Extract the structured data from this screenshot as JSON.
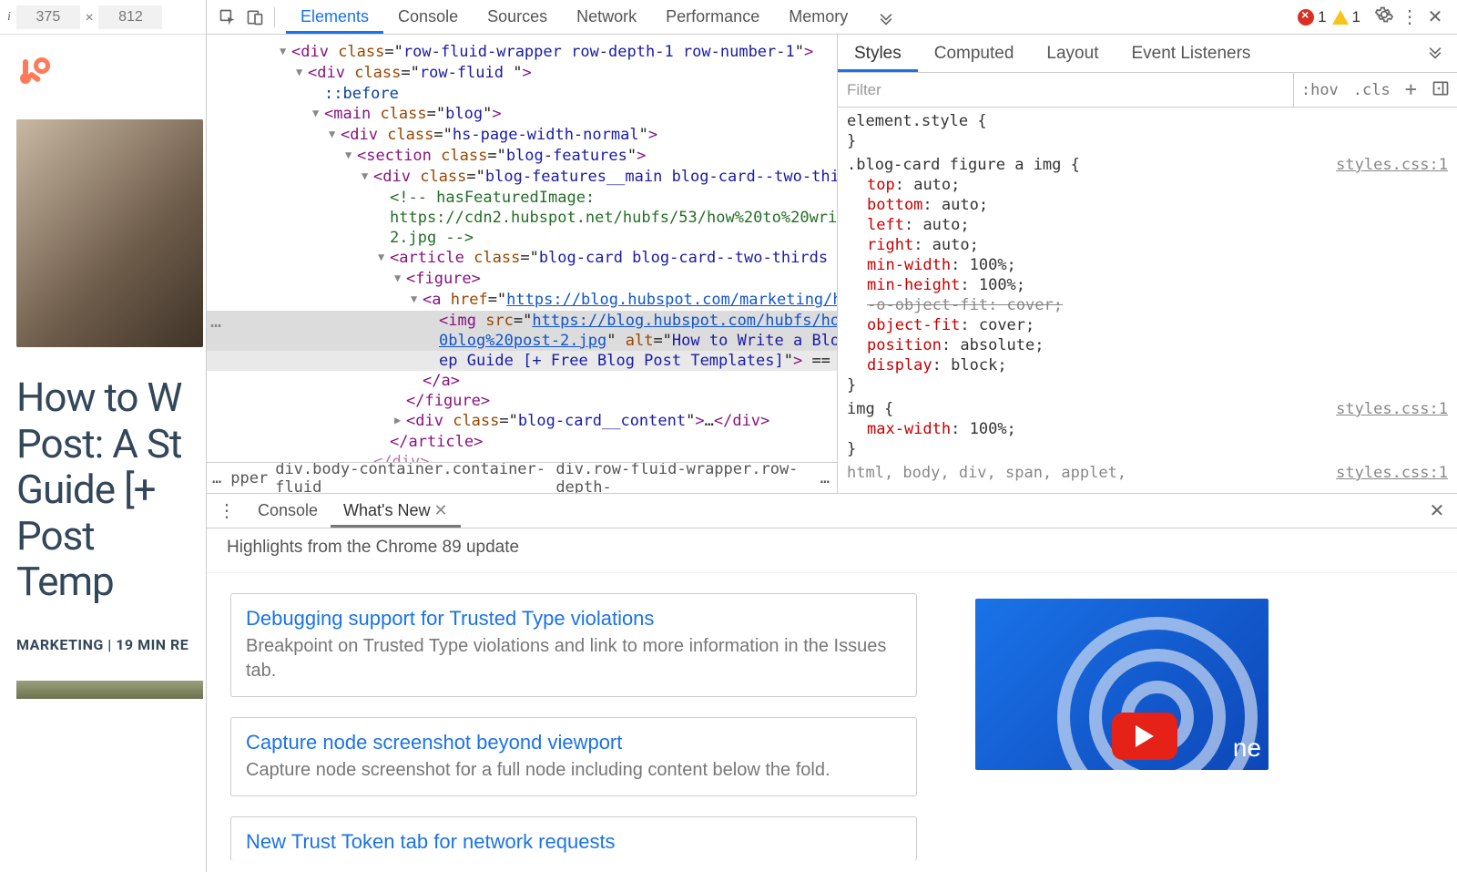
{
  "preview": {
    "width": "375",
    "height": "812",
    "article_title": "How to W\nPost: A St\nGuide [+ \nPost Temp",
    "meta": "MARKETING | 19 MIN RE"
  },
  "toolbar": {
    "tabs": [
      "Elements",
      "Console",
      "Sources",
      "Network",
      "Performance",
      "Memory"
    ],
    "active_tab": "Elements",
    "error_count": "1",
    "warning_count": "1"
  },
  "dom": {
    "ellipsis_marker": "…",
    "lines": [
      {
        "ind": 1,
        "tw": "▼",
        "html": "<span class='tag'>&lt;div</span> <span class='attr-n'>class</span>=\"<span class='attr-v'>row-fluid-wrapper row-depth-1 row-number-1</span>\"<span class='tag'>&gt;</span>"
      },
      {
        "ind": 2,
        "tw": "▼",
        "html": "<span class='tag'>&lt;div</span> <span class='attr-n'>class</span>=\"<span class='attr-v'>row-fluid </span>\"<span class='tag'>&gt;</span>"
      },
      {
        "ind": 3,
        "tw": "",
        "html": "<span class='pseudo'>::before</span>"
      },
      {
        "ind": 3,
        "tw": "▼",
        "html": "<span class='tag'>&lt;main</span> <span class='attr-n'>class</span>=\"<span class='attr-v'>blog</span>\"<span class='tag'>&gt;</span>"
      },
      {
        "ind": 4,
        "tw": "▼",
        "html": "<span class='tag'>&lt;div</span> <span class='attr-n'>class</span>=\"<span class='attr-v'>hs-page-width-normal</span>\"<span class='tag'>&gt;</span>"
      },
      {
        "ind": 5,
        "tw": "▼",
        "html": "<span class='tag'>&lt;section</span> <span class='attr-n'>class</span>=\"<span class='attr-v'>blog-features</span>\"<span class='tag'>&gt;</span>"
      },
      {
        "ind": 6,
        "tw": "▼",
        "html": "<span class='tag'>&lt;div</span> <span class='attr-n'>class</span>=\"<span class='attr-v'>blog-features__main blog-card--two-thi</span>"
      },
      {
        "ind": 7,
        "tw": "",
        "html": "<span class='comment'>&lt;!-- hasFeaturedImage:</span>"
      },
      {
        "ind": 7,
        "tw": "",
        "html": "<span class='comment'>https://cdn2.hubspot.net/hubfs/53/how%20to%20wri</span>"
      },
      {
        "ind": 7,
        "tw": "",
        "html": "<span class='comment'>2.jpg --&gt;</span>"
      },
      {
        "ind": 7,
        "tw": "▼",
        "html": "<span class='tag'>&lt;article</span> <span class='attr-n'>class</span>=\"<span class='attr-v'>blog-card blog-card--two-thirds </span>"
      },
      {
        "ind": 8,
        "tw": "▼",
        "html": "<span class='tag'>&lt;figure&gt;</span>"
      },
      {
        "ind": 9,
        "tw": "▼",
        "html": "<span class='tag'>&lt;a</span> <span class='attr-n'>href</span>=\"<span class='linkv'>https://blog.hubspot.com/marketing/h</span>"
      },
      {
        "ind": 10,
        "tw": "",
        "sel": true,
        "ell": true,
        "html": "<span class='tag'>&lt;img</span> <span class='attr-n'>src</span>=\"<span class='linkv'>https://blog.hubspot.com/hubfs/ho</span>"
      },
      {
        "ind": 10,
        "tw": "",
        "sel": true,
        "html": "<span class='linkv'>0blog%20post-2.jpg</span>\" <span class='attr-n'>alt</span>=\"<span class='attr-v'>How to Write a Blo</span>"
      },
      {
        "ind": 10,
        "tw": "",
        "sel2": true,
        "html": "<span class='attr-v'>ep Guide [+ Free Blog Post Templates]</span>\"<span class='tag'>&gt;</span> =="
      },
      {
        "ind": 9,
        "tw": "",
        "html": "<span class='tag'>&lt;/a&gt;</span>"
      },
      {
        "ind": 8,
        "tw": "",
        "html": "<span class='tag'>&lt;/figure&gt;</span>"
      },
      {
        "ind": 8,
        "tw": "▶",
        "html": "<span class='tag'>&lt;div</span> <span class='attr-n'>class</span>=\"<span class='attr-v'>blog-card__content</span>\"<span class='tag'>&gt;</span>…<span class='tag'>&lt;/div&gt;</span>"
      },
      {
        "ind": 7,
        "tw": "",
        "html": "<span class='tag'>&lt;/article&gt;</span>"
      },
      {
        "ind": 6,
        "tw": "",
        "html": "<span class='tag'>&lt;/div&gt;</span>",
        "faded": true
      }
    ]
  },
  "breadcrumbs": {
    "left_ell": "…",
    "items": [
      "pper",
      "div.body-container.container-fluid",
      "div.row-fluid-wrapper.row-depth-"
    ],
    "right_ell": "…"
  },
  "styles_tabs": {
    "tabs": [
      "Styles",
      "Computed",
      "Layout",
      "Event Listeners"
    ],
    "active": "Styles"
  },
  "styles_filter": {
    "placeholder": "Filter",
    "hov": ":hov",
    "cls": ".cls"
  },
  "rules": [
    {
      "selector": "element.style",
      "link": "",
      "decls": []
    },
    {
      "selector": ".blog-card figure a img",
      "link": "styles.css:1",
      "decls": [
        {
          "p": "top",
          "v": "auto;"
        },
        {
          "p": "bottom",
          "v": "auto;"
        },
        {
          "p": "left",
          "v": "auto;"
        },
        {
          "p": "right",
          "v": "auto;"
        },
        {
          "p": "min-width",
          "v": "100%;"
        },
        {
          "p": "min-height",
          "v": "100%;"
        },
        {
          "p": "-o-object-fit",
          "v": "cover;",
          "strike": true
        },
        {
          "p": "object-fit",
          "v": "cover;"
        },
        {
          "p": "position",
          "v": "absolute;"
        },
        {
          "p": "display",
          "v": "block;"
        }
      ]
    },
    {
      "selector": "img",
      "link": "styles.css:1",
      "decls": [
        {
          "p": "max-width",
          "v": "100%;"
        }
      ]
    },
    {
      "selector_inherit": "html, body, div, span, applet,",
      "link": "styles.css:1"
    }
  ],
  "drawer": {
    "tabs": [
      "Console",
      "What's New"
    ],
    "active": "What's New",
    "subtitle": "Highlights from the Chrome 89 update",
    "cards": [
      {
        "title": "Debugging support for Trusted Type violations",
        "desc": "Breakpoint on Trusted Type violations and link to more information in the Issues tab."
      },
      {
        "title": "Capture node screenshot beyond viewport",
        "desc": "Capture node screenshot for a full node including content below the fold."
      },
      {
        "title": "New Trust Token tab for network requests",
        "desc": ""
      }
    ],
    "video_label": "ne"
  }
}
